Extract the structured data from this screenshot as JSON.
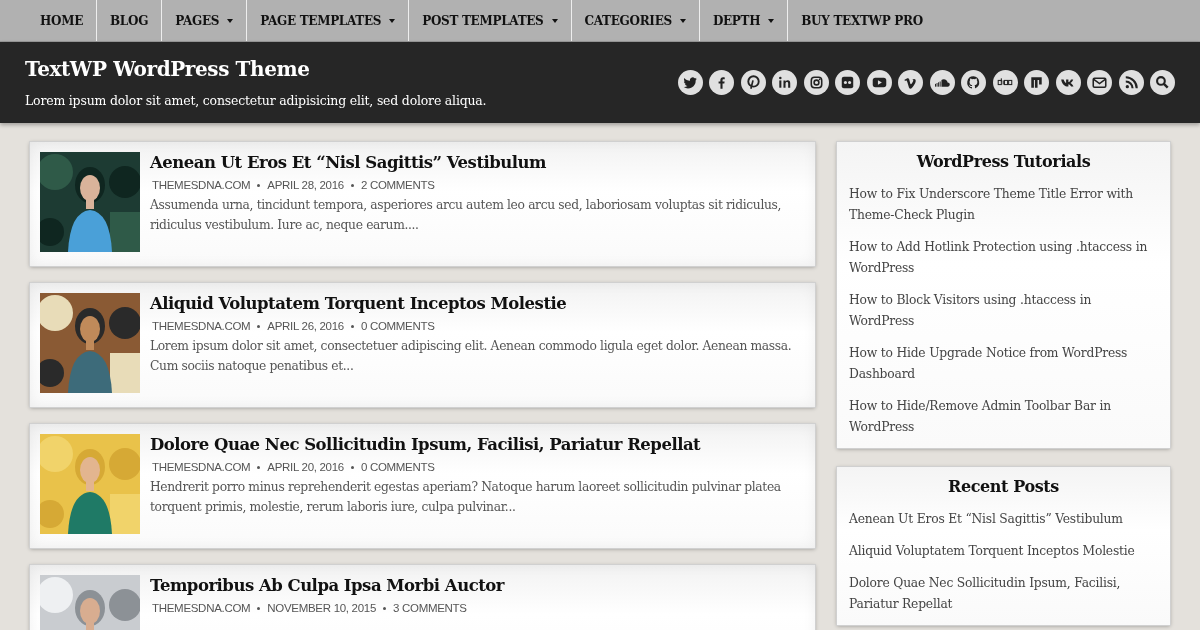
{
  "nav": [
    {
      "label": "HOME",
      "dropdown": false
    },
    {
      "label": "BLOG",
      "dropdown": false
    },
    {
      "label": "PAGES",
      "dropdown": true
    },
    {
      "label": "PAGE TEMPLATES",
      "dropdown": true
    },
    {
      "label": "POST TEMPLATES",
      "dropdown": true
    },
    {
      "label": "CATEGORIES",
      "dropdown": true
    },
    {
      "label": "DEPTH",
      "dropdown": true
    },
    {
      "label": "BUY TEXTWP PRO",
      "dropdown": false
    }
  ],
  "header": {
    "site_title": "TextWP WordPress Theme",
    "tagline": "Lorem ipsum dolor sit amet, consectetur adipisicing elit, sed dolore aliqua."
  },
  "posts": [
    {
      "title": "Aenean Ut Eros Et “Nisl Sagittis” Vestibulum",
      "author": "THEMESDNA.COM",
      "date": "APRIL 28, 2016",
      "comments": "2 COMMENTS",
      "excerpt": "Assumenda urna, tincidunt tempora, asperiores arcu autem leo arcu sed, laboriosam voluptas sit ridiculus, ridiculus vestibulum. Iure ac, neque earum...."
    },
    {
      "title": "Aliquid Voluptatem Torquent Inceptos Molestie",
      "author": "THEMESDNA.COM",
      "date": "APRIL 26, 2016",
      "comments": "0 COMMENTS",
      "excerpt": "Lorem ipsum dolor sit amet, consectetuer adipiscing elit. Aenean commodo ligula eget dolor. Aenean massa. Cum sociis natoque penatibus et..."
    },
    {
      "title": "Dolore Quae Nec Sollicitudin Ipsum, Facilisi, Pariatur Repellat",
      "author": "THEMESDNA.COM",
      "date": "APRIL 20, 2016",
      "comments": "0 COMMENTS",
      "excerpt": "Hendrerit porro minus reprehenderit egestas aperiam? Natoque harum laoreet sollicitudin pulvinar platea torquent primis, molestie, rerum laboris iure, culpa pulvinar..."
    },
    {
      "title": "Temporibus Ab Culpa Ipsa Morbi Auctor",
      "author": "THEMESDNA.COM",
      "date": "NOVEMBER 10, 2015",
      "comments": "3 COMMENTS"
    }
  ],
  "sidebar": [
    {
      "title": "WordPress Tutorials",
      "links": [
        "How to Fix Underscore Theme Title Error with Theme-Check Plugin",
        "How to Add Hotlink Protection using .htaccess in WordPress",
        "How to Block Visitors using .htaccess in WordPress",
        "How to Hide Upgrade Notice from WordPress Dashboard",
        "How to Hide/Remove Admin Toolbar Bar in WordPress"
      ]
    },
    {
      "title": "Recent Posts",
      "links": [
        "Aenean Ut Eros Et “Nisl Sagittis” Vestibulum",
        "Aliquid Voluptatem Torquent Inceptos Molestie",
        "Dolore Quae Nec Sollicitudin Ipsum, Facilisi, Pariatur Repellat"
      ]
    }
  ]
}
